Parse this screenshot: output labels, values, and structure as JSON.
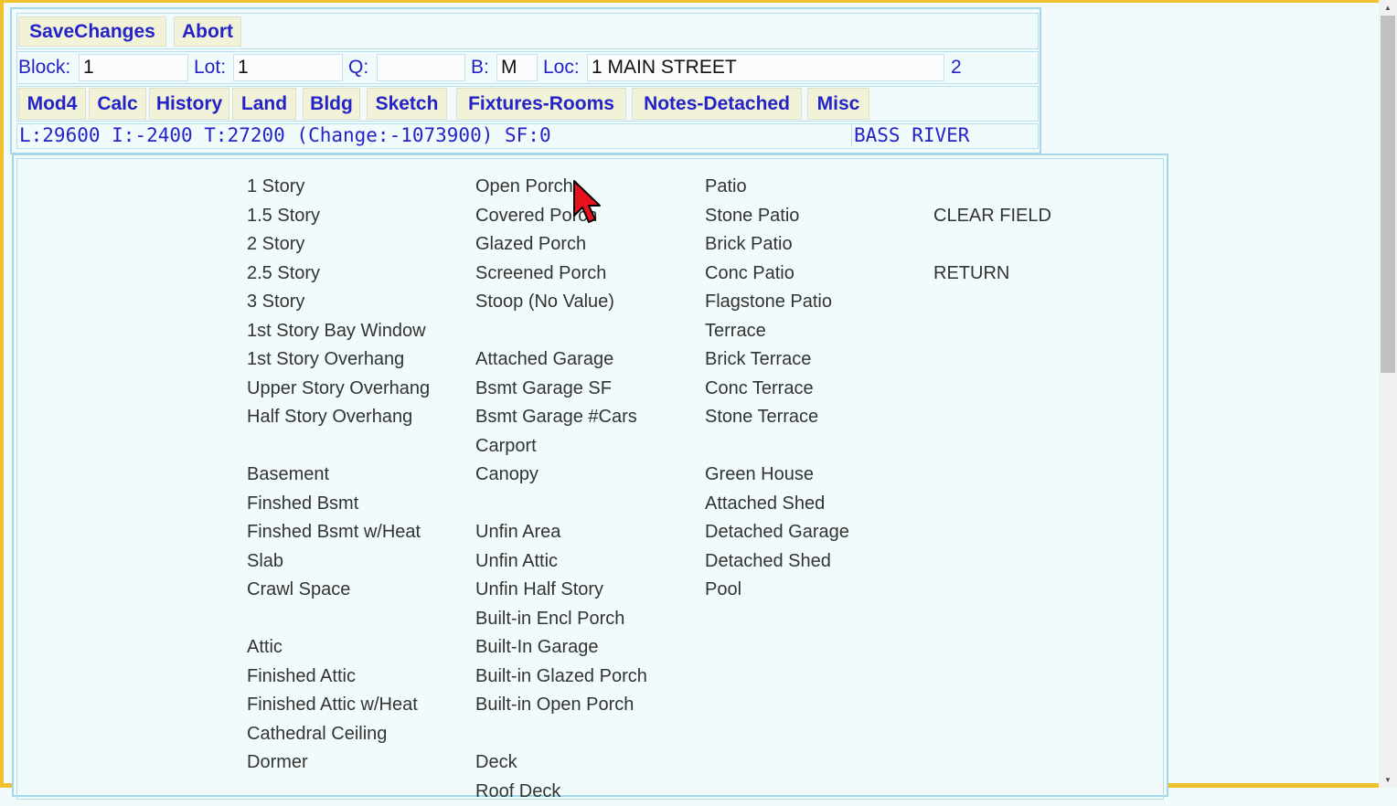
{
  "toolbar": {
    "save_label": "SaveChanges",
    "abort_label": "Abort"
  },
  "property": {
    "block_label": "Block:",
    "block_value": "1",
    "lot_label": "Lot:",
    "lot_value": "1",
    "qual_label": "Q:",
    "qual_value": "",
    "bldg_label": "B:",
    "bldg_value": "M",
    "loc_label": "Loc:",
    "loc_value": "1 MAIN STREET",
    "count": "2"
  },
  "tabs": [
    {
      "label": "Mod4"
    },
    {
      "label": "Calc"
    },
    {
      "label": "History"
    },
    {
      "label": "Land"
    },
    {
      "label": "Bldg"
    },
    {
      "label": "Sketch"
    },
    {
      "label": "Fixtures-Rooms"
    },
    {
      "label": "Notes-Detached"
    },
    {
      "label": "Misc"
    }
  ],
  "summary": {
    "text": "L:29600 I:-2400 T:27200 (Change:-1073900) SF:0",
    "district": "BASS RIVER"
  },
  "columns": [
    {
      "items": [
        "1 Story",
        "1.5 Story",
        "2 Story",
        "2.5 Story",
        "3 Story",
        "1st Story Bay Window",
        "1st Story Overhang",
        "Upper Story Overhang",
        "Half Story Overhang",
        "",
        "Basement",
        "Finshed Bsmt",
        "Finshed Bsmt w/Heat",
        "Slab",
        "Crawl Space",
        "",
        "Attic",
        "Finished Attic",
        "Finished Attic w/Heat",
        "Cathedral Ceiling",
        "Dormer"
      ]
    },
    {
      "items": [
        "Open Porch",
        "Covered Porch",
        "Glazed Porch",
        "Screened Porch",
        "Stoop (No Value)",
        "",
        "Attached Garage",
        "Bsmt Garage SF",
        "Bsmt Garage #Cars",
        "Carport",
        "Canopy",
        "",
        "Unfin Area",
        "Unfin Attic",
        "Unfin Half Story",
        "Built-in Encl Porch",
        "Built-In Garage",
        "Built-in Glazed Porch",
        "Built-in Open Porch",
        "",
        "Deck",
        "Roof Deck"
      ]
    },
    {
      "items": [
        "Patio",
        "Stone Patio",
        "Brick Patio",
        "Conc Patio",
        "Flagstone Patio",
        "Terrace",
        "Brick Terrace",
        "Conc Terrace",
        "Stone Terrace",
        "",
        "Green House",
        "Attached Shed",
        "Detached Garage",
        "Detached Shed",
        "Pool"
      ]
    },
    {
      "items": [
        "",
        "CLEAR FIELD",
        "",
        "RETURN"
      ]
    }
  ]
}
